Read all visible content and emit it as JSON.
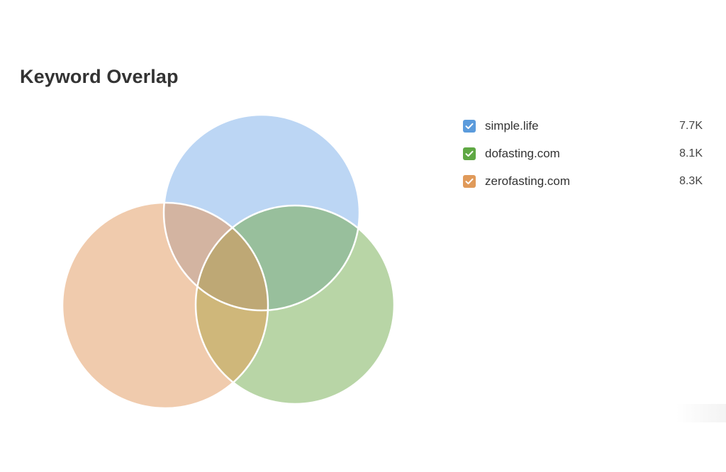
{
  "title": "Keyword Overlap",
  "legend": [
    {
      "label": "simple.life",
      "value": "7.7K",
      "color": "#5b9bdc",
      "icon": "check-icon"
    },
    {
      "label": "dofasting.com",
      "value": "8.1K",
      "color": "#5fa844",
      "icon": "check-icon"
    },
    {
      "label": "zerofasting.com",
      "value": "8.3K",
      "color": "#e09a5a",
      "icon": "check-icon"
    }
  ],
  "chart_data": {
    "type": "venn",
    "title": "Keyword Overlap",
    "sets": [
      {
        "name": "simple.life",
        "value": 7700,
        "label": "7.7K",
        "fill": "#bcd6f4"
      },
      {
        "name": "dofasting.com",
        "value": 8100,
        "label": "8.1K",
        "fill": "#b8d5a6"
      },
      {
        "name": "zerofasting.com",
        "value": 8300,
        "label": "8.3K",
        "fill": "#f0cbad"
      }
    ],
    "intersection_fills": {
      "simple.life&zerofasting.com": "#d3b4a1",
      "simple.life&dofasting.com": "#98bf9c",
      "dofasting.com&zerofasting.com": "#cfb77a",
      "all": "#bea875"
    },
    "legend_position": "top-right"
  }
}
